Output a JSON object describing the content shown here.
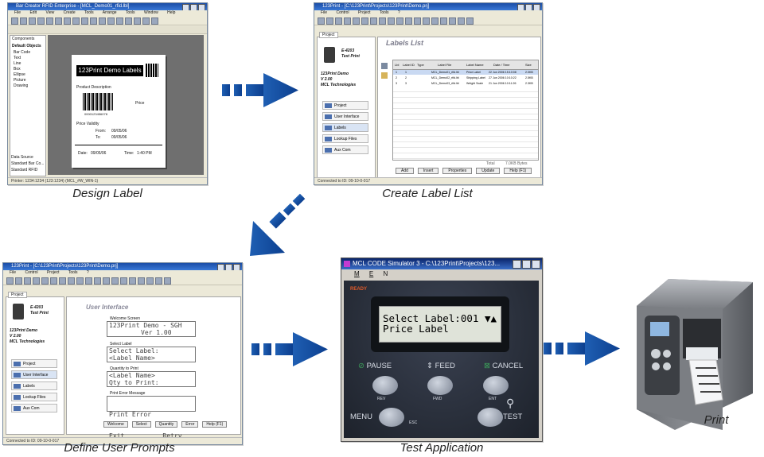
{
  "steps": [
    {
      "caption": "Design Label"
    },
    {
      "caption": "Create Label List"
    },
    {
      "caption": "Define User Prompts"
    },
    {
      "caption": "Test Application"
    },
    {
      "caption": "Print"
    }
  ],
  "designer": {
    "title": "Bar Creator RFID Enterprise - [MCL_Demo01_rfid.lbl]",
    "menu": [
      "File",
      "Edit",
      "View",
      "Create",
      "Tools",
      "Arrange",
      "Tools",
      "Window",
      "Help"
    ],
    "side_items": [
      "Components",
      "Default Objects",
      "Bar Code",
      "Text",
      "Line",
      "Box",
      "Ellipse",
      "Picture",
      "Drawing"
    ],
    "side_bottom": [
      "Data Source",
      "Standard Bar Co...",
      "Standard RFID"
    ],
    "label": {
      "header": "123Print Demo Labels",
      "product_description": "Product Description",
      "barcode_text": "0000123456078",
      "price": "Price",
      "price_validity": "Price Validity",
      "from_label": "From:",
      "from_value": "09/05/06",
      "to_label": "To:",
      "to_value": "09/05/06",
      "date_label": "Date:",
      "date_value": "09/05/06",
      "time_label": "Time:",
      "time_value": "1:40 PM"
    },
    "status": "Printer: 1234:1234 (123:1234) (MCL_#W_WIN-1)"
  },
  "labels_window": {
    "title": "123Print - [C:\\123Print\\Projects\\123Print\\Demo.prj]",
    "menu": [
      "File",
      "Control",
      "Project",
      "Tools",
      "?"
    ],
    "tab": "Project",
    "device_name": "E-4203",
    "device_sub": "Text Print",
    "app_name": "123Print Demo",
    "version": "V 2.00",
    "company": "MCL Technologies",
    "nav": [
      "Project",
      "User Interface",
      "Labels",
      "Lookup Files",
      "Aux Com"
    ],
    "heading": "Labels List",
    "columns": [
      "Lbl",
      "Label ID",
      "Type",
      "Label File",
      "Label Name",
      "Date / Time",
      "Size"
    ],
    "rows": [
      [
        "1",
        "1",
        "MCL_Demo01_rfid.lbl",
        "Price Label",
        "22 Jun 2006 15:10:08",
        "2.0KB"
      ],
      [
        "2",
        "2",
        "MCL_Demo02_rfid.lbl",
        "Shipping Label",
        "27 Jun 2006 10:10:22",
        "2.5KB"
      ],
      [
        "3",
        "3",
        "MCL_Demo03_rfid.lbl",
        "Weight Scale",
        "21 Jun 2006 10:11:26",
        "2.3KB"
      ]
    ],
    "total_label": "Total",
    "total_value": "7.0KB Bytes",
    "buttons": [
      "Add",
      "Insert",
      "Properties",
      "Update",
      "Help (F1)"
    ],
    "status": "Connected to ID: 09-10-0-017"
  },
  "prompts_window": {
    "title": "123Print - [C:\\123Print\\Projects\\123Print\\Demo.prj]",
    "heading": "User Interface",
    "welcome_label": "Welcome Screen",
    "welcome_line1": "123Print Demo - SGH",
    "welcome_line2": "Ver 1.00",
    "select_label": "Select Label",
    "select_line1": "Select Label:",
    "select_line2": "<Label Name>",
    "quantity_label": "Quantity to Print",
    "quantity_line1": "<Label Name>",
    "quantity_line2": "Qty to Print:",
    "error_label": "Print Error Message",
    "error_line1": "Print Error",
    "error_line2": "Exit          Retry",
    "buttons": [
      "Welcome",
      "Select",
      "Quantity",
      "Error",
      "Help (F1)"
    ],
    "status": "Connected to ID: 09-10-0-017"
  },
  "simulator": {
    "title": "MCL CODE Simulator 3 - C:\\123Print\\Projects\\123...",
    "menu": "MENU",
    "brand": "READY",
    "lcd_line1": "Select Label:001",
    "lcd_arrows": "▼▲",
    "lcd_line2": "Price Label",
    "pause": "PAUSE",
    "feed": "FEED",
    "cancel": "CANCEL",
    "rev": "REV",
    "fwd": "FWD",
    "ent": "ENT",
    "esc": "ESC",
    "test": "TEST"
  },
  "colors": {
    "arrow": "#1a5fb4",
    "title_bar": "#1b4da6",
    "sim_panel": "#2d3440",
    "lcd": "#dfe3d9"
  }
}
